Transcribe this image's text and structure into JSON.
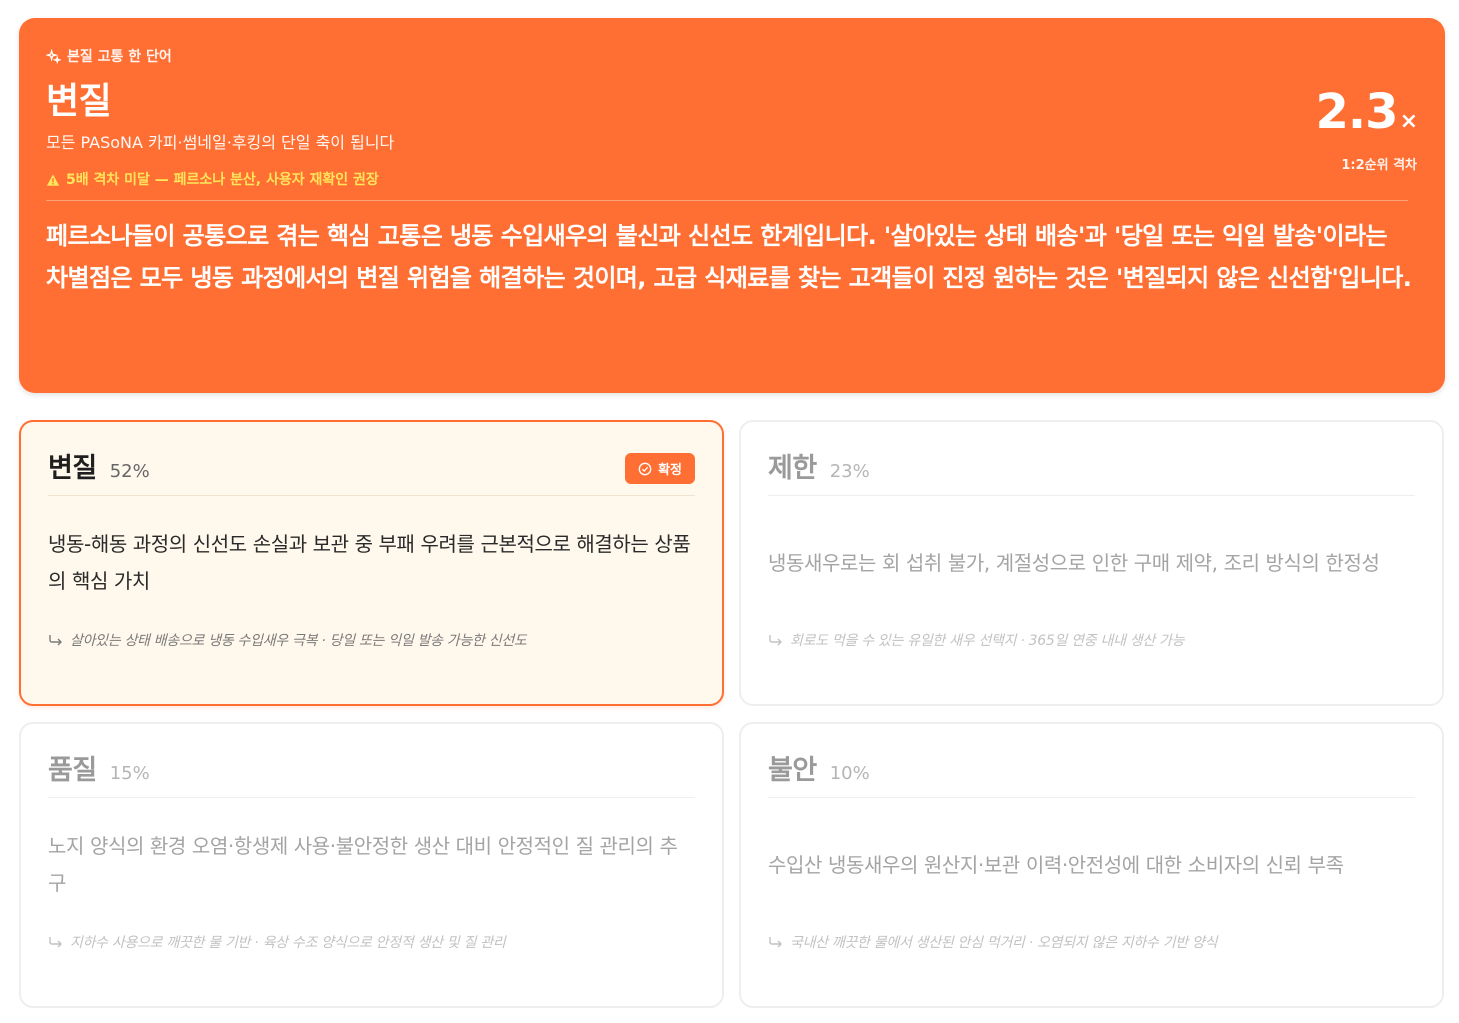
{
  "hero": {
    "eyebrow": "본질 고통 한 단어",
    "word": "변질",
    "subtitle": "모든 PASoNA 카피·썸네일·후킹의 단일 축이 됩니다",
    "warning": "5배 격차 미달 — 페르소나 분산, 사용자 재확인 권장",
    "ratio_value": "2.3",
    "ratio_unit": "×",
    "ratio_caption": "1:2순위 격차",
    "summary": "페르소나들이 공통으로 겪는 핵심 고통은 냉동 수입새우의 불신과 신선도 한계입니다. '살아있는 상태 배송'과 '당일 또는 익일 발송'이라는 차별점은 모두 냉동 과정에서의 변질 위험을 해결하는 것이며, 고급 식재료를 찾는 고객들이 진정 원하는 것은 '변질되지 않은 신선함'입니다.",
    "colors": {
      "accent": "#ff6f33",
      "warning": "#ffe45c"
    }
  },
  "cards": [
    {
      "title": "변질",
      "percent": "52%",
      "badge": "확정",
      "description": "냉동-해동 과정의 신선도 손실과 보관 중 부패 우려를 근본적으로 해결하는 상품의 핵심 가치",
      "evidence": "살아있는 상태 배송으로 냉동 수입새우 극복 · 당일 또는 익일 발송 가능한 신선도"
    },
    {
      "title": "제한",
      "percent": "23%",
      "description": "냉동새우로는 회 섭취 불가, 계절성으로 인한 구매 제약, 조리 방식의 한정성",
      "evidence": "회로도 먹을 수 있는 유일한 새우 선택지 · 365일 연중 내내 생산 가능"
    },
    {
      "title": "품질",
      "percent": "15%",
      "description": "노지 양식의 환경 오염·항생제 사용·불안정한 생산 대비 안정적인 질 관리의 추구",
      "evidence": "지하수 사용으로 깨끗한 물 기반 · 육상 수조 양식으로 안정적 생산 및 질 관리"
    },
    {
      "title": "불안",
      "percent": "10%",
      "description": "수입산 냉동새우의 원산지·보관 이력·안전성에 대한 소비자의 신뢰 부족",
      "evidence": "국내산 깨끗한 물에서 생산된 안심 먹거리 · 오염되지 않은 지하수 기반 양식"
    }
  ]
}
